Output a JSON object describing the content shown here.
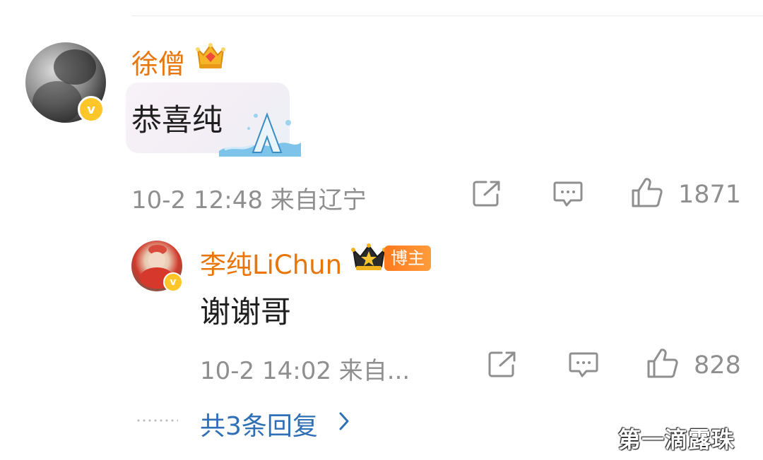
{
  "main_comment": {
    "username": "徐僧",
    "badge_icon": "crown-gem-icon",
    "text": "恭喜纯",
    "bubble_decoration": "A",
    "timestamp": "10-2 12:48",
    "location": "来自辽宁",
    "like_count": "1871",
    "actions": [
      "share-icon",
      "comment-icon",
      "like-icon"
    ]
  },
  "reply": {
    "username": "李纯LiChun",
    "badge_icon": "crown-star-icon",
    "author_tag": "博主",
    "text": "谢谢哥",
    "timestamp": "10-2 14:02",
    "location": "来自...",
    "like_count": "828",
    "actions": [
      "share-icon",
      "comment-icon",
      "like-icon"
    ]
  },
  "more_replies": {
    "label": "共3条回复"
  },
  "watermark": "第一滴露珠",
  "colors": {
    "username": "#e8760a",
    "link": "#2f6fb5",
    "meta": "#8f8f8f",
    "verified": "#ffc62a"
  }
}
